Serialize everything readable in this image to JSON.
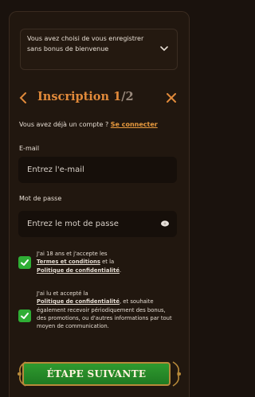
{
  "notice": {
    "text": "Vous avez choisi de vous enregistrer sans bonus de bienvenue",
    "chevron_icon": "chevron-down-icon"
  },
  "header": {
    "title": "Inscription",
    "step_current": "1",
    "step_total": "/2",
    "back_icon": "chevron-left-icon",
    "close_icon": "close-icon"
  },
  "login": {
    "prompt": "Vous avez déjà un compte ?",
    "link": "Se connecter"
  },
  "email": {
    "label": "E-mail",
    "placeholder": "Entrez l'e-mail"
  },
  "password": {
    "label": "Mot de passe",
    "placeholder": "Entrez le mot de passe",
    "eye_icon": "eye-icon"
  },
  "consent_terms": {
    "checked": true,
    "text_1": "J'ai 18 ans et j'accepte les",
    "link_terms": "Termes et conditions",
    "text_2": "et la",
    "link_privacy": "Politique de confidentialité",
    "text_3": "."
  },
  "consent_marketing": {
    "checked": true,
    "text_1": "J'ai lu et accepté la",
    "link_privacy": "Politique de confidentialité",
    "text_2": ", et souhaite également recevoir périodiquement des bonus, des promotions, ou d'autres informations par tout moyen de communication."
  },
  "cta": {
    "label": "ÉTAPE SUIVANTE"
  },
  "colors": {
    "accent": "#e0893a",
    "link": "#e89a3e",
    "checkbox": "#2fae35",
    "button": "#2f9a2f",
    "background": "#1a120d"
  }
}
